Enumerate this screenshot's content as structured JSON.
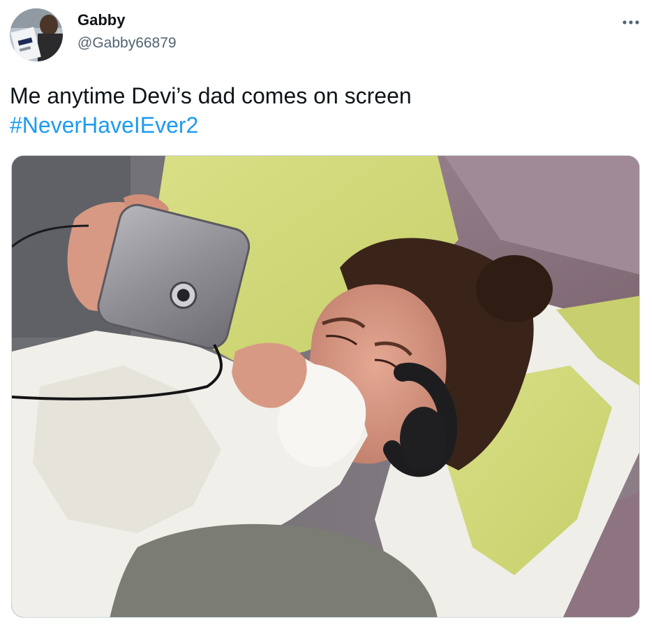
{
  "author": {
    "display_name": "Gabby",
    "handle": "@Gabby66879",
    "avatar_icon": "profile-photo"
  },
  "tweet": {
    "text": "Me anytime Devi’s dad comes on screen",
    "hashtag": "#NeverHaveIEver2"
  },
  "actions": {
    "more_icon": "more-horizontal-icon"
  },
  "media": {
    "description_icon": "photo"
  },
  "colors": {
    "link": "#1d9bf0",
    "text": "#0f1419",
    "secondary_text": "#536471",
    "media_border": "#cfd9de"
  }
}
